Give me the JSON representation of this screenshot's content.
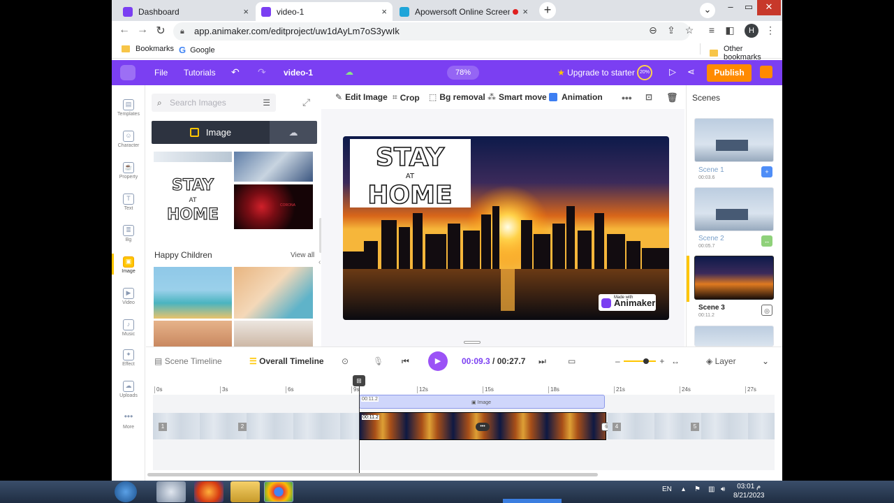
{
  "browser": {
    "tabs": [
      {
        "title": "Dashboard",
        "close": "×"
      },
      {
        "title": "video-1",
        "close": "×"
      },
      {
        "title": "Apowersoft Online Screen Re",
        "close": "×"
      }
    ],
    "new_tab": "+",
    "url": "app.animaker.com/editproject/uw1dAyLm7oS3ywIk",
    "profile_initial": "H",
    "bookmarks": [
      {
        "label": "Bookmarks"
      },
      {
        "label": "Google"
      }
    ],
    "other_bookmarks": "Other bookmarks"
  },
  "toolbar": {
    "file": "File",
    "tutorials": "Tutorials",
    "project_name": "video-1",
    "zoom": "78%",
    "upgrade": "Upgrade to starter",
    "progress": "20%",
    "publish": "Publish"
  },
  "rail": [
    {
      "label": "Templates",
      "icon": "templates-icon"
    },
    {
      "label": "Character",
      "icon": "character-icon"
    },
    {
      "label": "Property",
      "icon": "property-icon"
    },
    {
      "label": "Text",
      "icon": "text-icon"
    },
    {
      "label": "Bg",
      "icon": "bg-icon"
    },
    {
      "label": "Image",
      "icon": "image-icon",
      "selected": true
    },
    {
      "label": "Video",
      "icon": "video-icon"
    },
    {
      "label": "Music",
      "icon": "music-icon"
    },
    {
      "label": "Effect",
      "icon": "effect-icon"
    },
    {
      "label": "Uploads",
      "icon": "uploads-icon"
    },
    {
      "label": "More",
      "icon": "more-icon"
    }
  ],
  "panel": {
    "search_placeholder": "Search Images",
    "tab_image": "Image",
    "section_title": "Happy Children",
    "view_all": "View all",
    "corona_text": "CORONA"
  },
  "edit_toolbar": {
    "edit_image": "Edit Image",
    "crop": "Crop",
    "bg_removal": "Bg removal",
    "smart_move": "Smart move",
    "animation": "Animation"
  },
  "stage": {
    "stay_lines": [
      "STAY",
      "AT",
      "HOME"
    ],
    "made_with": "Made with",
    "brand": "Animaker"
  },
  "scenes": {
    "title": "Scenes",
    "items": [
      {
        "label": "Scene 1",
        "time": "00:03.6",
        "badge": "+",
        "badge_color": "#4f8ef7"
      },
      {
        "label": "Scene 2",
        "time": "00:05.7",
        "badge": "↔",
        "badge_color": "#8fd17a"
      },
      {
        "label": "Scene 3",
        "time": "00:11.2",
        "badge": "◎",
        "badge_color": "#ffffff",
        "active": true
      }
    ]
  },
  "timeline": {
    "scene_timeline": "Scene Timeline",
    "overall_timeline": "Overall Timeline",
    "current_time": "00:09.3",
    "separator": "/",
    "total_time": "00:27.7",
    "layer": "Layer",
    "ruler": [
      "0s",
      "3s",
      "6s",
      "9s",
      "12s",
      "15s",
      "18s",
      "21s",
      "24s",
      "27s"
    ],
    "image_clip_time": "00:11.2",
    "image_clip_label": "Image",
    "scene_clip_time": "00:11.2",
    "segment_numbers": [
      "1",
      "2",
      "4",
      "5"
    ]
  },
  "taskbar": {
    "lang": "EN",
    "time": "03:01 م",
    "date": "8/21/2023"
  }
}
